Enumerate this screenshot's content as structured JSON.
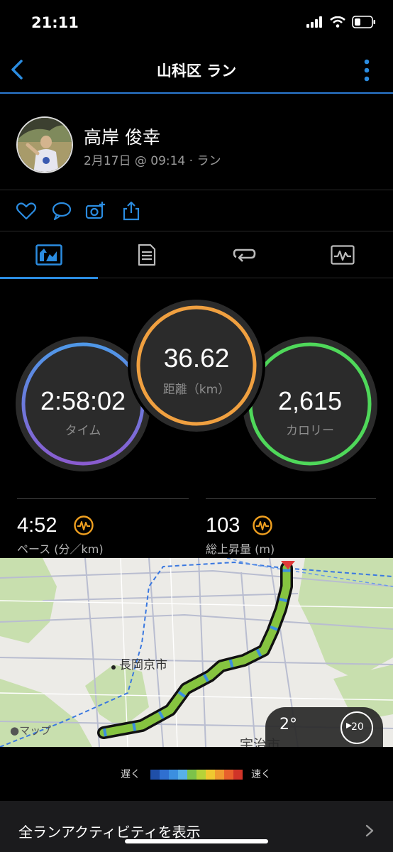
{
  "status_bar": {
    "time": "21:11"
  },
  "header": {
    "title": "山科区 ラン"
  },
  "profile": {
    "name": "高岸 俊幸",
    "meta": "2月17日 @ 09:14 · ラン"
  },
  "stats": {
    "time": {
      "value": "2:58:02",
      "label": "タイム"
    },
    "distance": {
      "value": "36.62",
      "label": "距離（km）"
    },
    "calories": {
      "value": "2,615",
      "label": "カロリー"
    }
  },
  "metrics": {
    "pace": {
      "value": "4:52",
      "label": "ペース (分／km)"
    },
    "ascent": {
      "value": "103",
      "label": "総上昇量 (m)"
    }
  },
  "map": {
    "city_label": "長岡京市",
    "city_label_2": "宇治市",
    "attribution": "マップ",
    "weather": {
      "temp": "2°",
      "wind": "20"
    }
  },
  "legend": {
    "slow": "遅く",
    "fast": "速く",
    "colors": [
      "#1f4fa8",
      "#2f6fd0",
      "#3b8fe0",
      "#58b0e8",
      "#7cc24a",
      "#b6d238",
      "#f0c830",
      "#f09a30",
      "#e8602c",
      "#d03428"
    ]
  },
  "footer": {
    "link": "全ランアクティビティを表示"
  },
  "colors": {
    "accent": "#2b8ce0",
    "ring_time": "#5a8ee8",
    "ring_distance": "#f0a040",
    "ring_calories": "#4fd85a"
  }
}
